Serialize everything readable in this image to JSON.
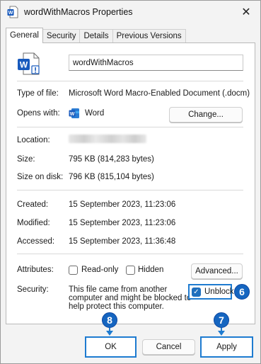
{
  "window": {
    "title": "wordWithMacros Properties",
    "close_glyph": "✕"
  },
  "tabs": [
    {
      "label": "General",
      "active": true
    },
    {
      "label": "Security",
      "active": false
    },
    {
      "label": "Details",
      "active": false
    },
    {
      "label": "Previous Versions",
      "active": false
    }
  ],
  "general": {
    "file_name": "wordWithMacros",
    "type_label": "Type of file:",
    "type_value": "Microsoft Word Macro-Enabled Document (.docm)",
    "opens_label": "Opens with:",
    "opens_value": "Word",
    "change_button": "Change...",
    "location_label": "Location:",
    "size_label": "Size:",
    "size_value": "795 KB (814,283 bytes)",
    "size_disk_label": "Size on disk:",
    "size_disk_value": "796 KB (815,104 bytes)",
    "created_label": "Created:",
    "created_value": "15 September 2023, 11:23:06",
    "modified_label": "Modified:",
    "modified_value": "15 September 2023, 11:23:06",
    "accessed_label": "Accessed:",
    "accessed_value": "15 September 2023, 11:36:48",
    "attributes_label": "Attributes:",
    "readonly_label": "Read-only",
    "readonly_checked": false,
    "hidden_label": "Hidden",
    "hidden_checked": false,
    "advanced_button": "Advanced...",
    "security_label": "Security:",
    "security_text_1": "This file came from another",
    "security_text_2": "computer and might be blocked to",
    "security_text_3": "help protect this computer.",
    "unblock_label": "Unblock",
    "unblock_checked": true
  },
  "footer": {
    "ok": "OK",
    "cancel": "Cancel",
    "apply": "Apply"
  },
  "annotations": {
    "unblock_step": "6",
    "apply_step": "7",
    "ok_step": "8"
  },
  "colors": {
    "accent": "#1e7bd0",
    "badge": "#1565c0",
    "word_blue": "#185abd"
  },
  "icons": {
    "title": "word-document-icon",
    "file": "word-macro-document-icon",
    "opens_with": "word-app-icon",
    "close": "close-icon",
    "unblock": "checkbox-checked-icon"
  }
}
